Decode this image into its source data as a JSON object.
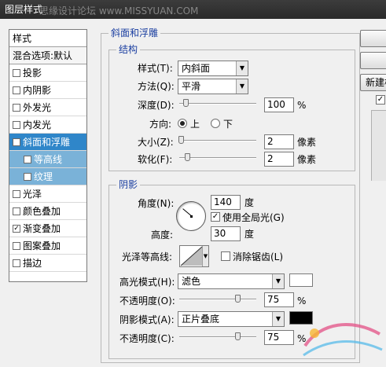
{
  "window": {
    "title": "图层样式",
    "watermark": "思缘设计论坛 www.MISSYUAN.COM"
  },
  "styles_panel": {
    "header": "样式",
    "blend_options": "混合选项:默认",
    "items": [
      {
        "label": "投影",
        "checked": false
      },
      {
        "label": "内阴影",
        "checked": false
      },
      {
        "label": "外发光",
        "checked": false
      },
      {
        "label": "内发光",
        "checked": false
      },
      {
        "label": "斜面和浮雕",
        "checked": true,
        "active": true
      },
      {
        "label": "等高线",
        "checked": false,
        "sub": true
      },
      {
        "label": "纹理",
        "checked": false,
        "sub": true
      },
      {
        "label": "光泽",
        "checked": false
      },
      {
        "label": "颜色叠加",
        "checked": false
      },
      {
        "label": "渐变叠加",
        "checked": true
      },
      {
        "label": "图案叠加",
        "checked": false
      },
      {
        "label": "描边",
        "checked": false
      }
    ]
  },
  "bevel": {
    "title": "斜面和浮雕",
    "structure": {
      "title": "结构",
      "style_label": "样式(T):",
      "style_value": "内斜面",
      "technique_label": "方法(Q):",
      "technique_value": "平滑",
      "depth_label": "深度(D):",
      "depth_value": "100",
      "depth_unit": "%",
      "depth_slider_fraction": 0.08,
      "direction_label": "方向:",
      "direction_up": "上",
      "direction_down": "下",
      "direction_selected": "上",
      "size_label": "大小(Z):",
      "size_value": "2",
      "size_unit": "像素",
      "size_slider_fraction": 0.02,
      "soften_label": "软化(F):",
      "soften_value": "2",
      "soften_unit": "像素",
      "soften_slider_fraction": 0.1
    },
    "shading": {
      "title": "阴影",
      "angle_label": "角度(N):",
      "angle_value": "140",
      "angle_unit": "度",
      "global_light_label": "使用全局光(G)",
      "global_light_checked": true,
      "altitude_label": "高度:",
      "altitude_value": "30",
      "altitude_unit": "度",
      "gloss_contour_label": "光泽等高线:",
      "anti_alias_label": "消除锯齿(L)",
      "anti_alias_checked": false,
      "highlight_mode_label": "高光模式(H):",
      "highlight_mode_value": "滤色",
      "highlight_color": "#ffffff",
      "highlight_opacity_label": "不透明度(O):",
      "highlight_opacity_value": "75",
      "highlight_opacity_unit": "%",
      "highlight_opacity_fraction": 0.75,
      "shadow_mode_label": "阴影模式(A):",
      "shadow_mode_value": "正片叠底",
      "shadow_color": "#000000",
      "shadow_opacity_label": "不透明度(C):",
      "shadow_opacity_value": "75",
      "shadow_opacity_unit": "%",
      "shadow_opacity_fraction": 0.75
    }
  },
  "buttons": {
    "new_style": "新建样式..."
  },
  "colors": {
    "accent": "#2f86c9",
    "sub_item": "#7ab2d8",
    "legend": "#1a3ea0"
  }
}
